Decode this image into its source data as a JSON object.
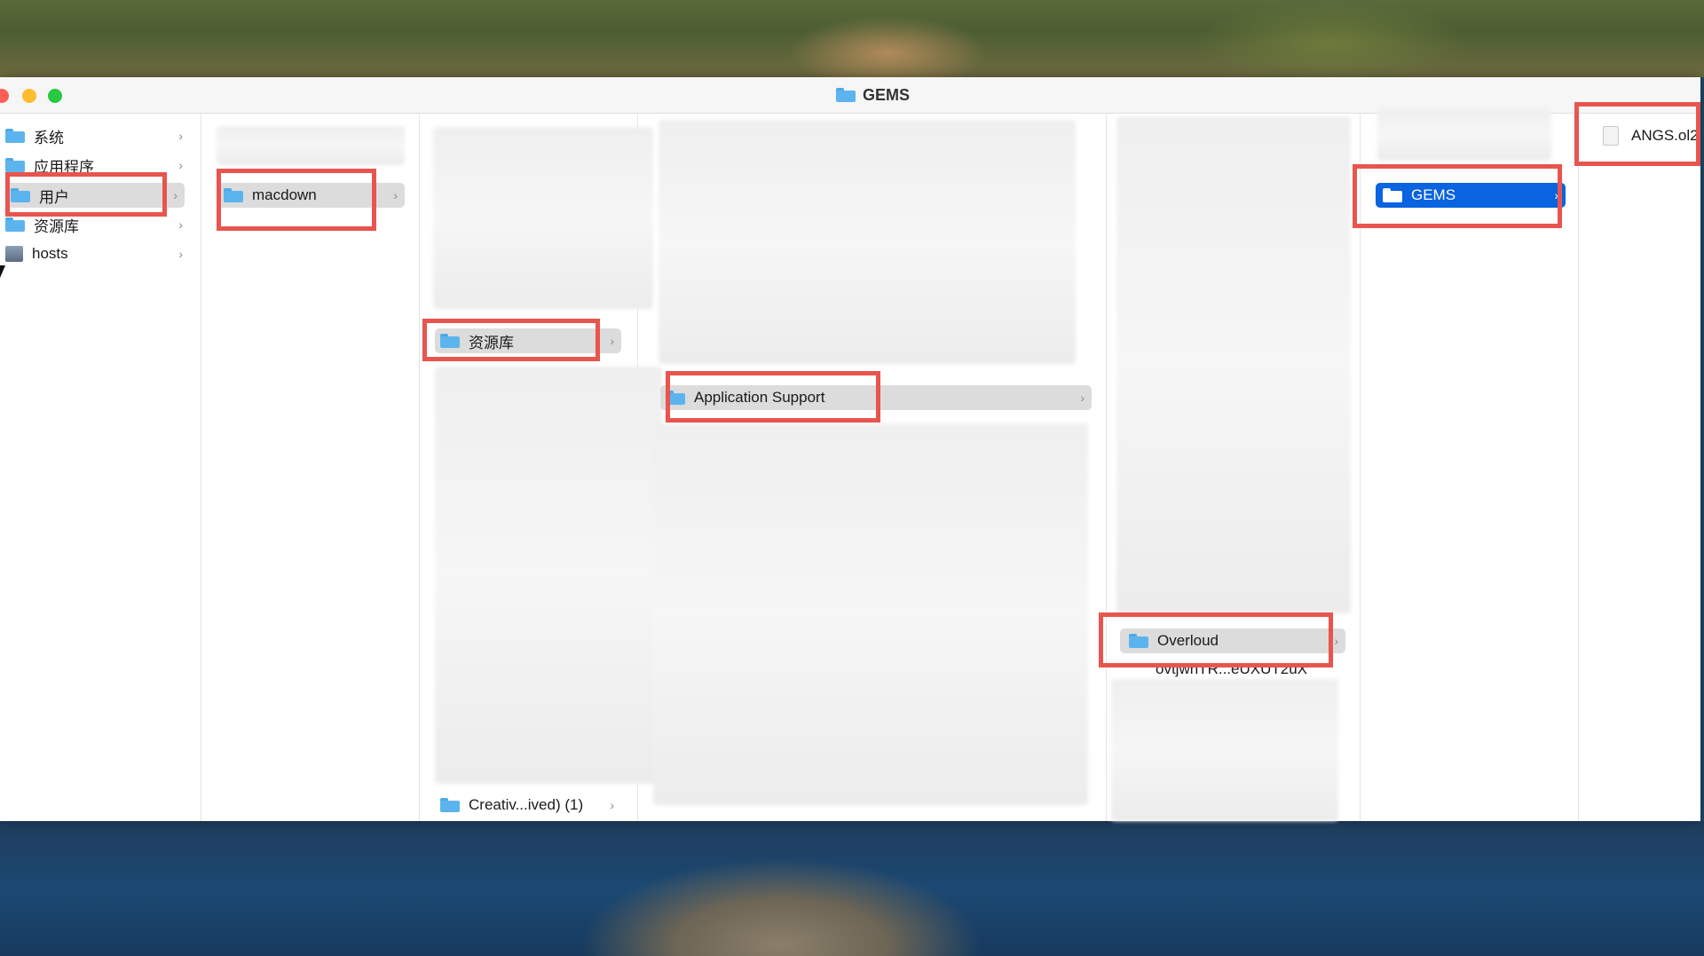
{
  "window": {
    "title": "GEMS"
  },
  "columns": {
    "sidebar": [
      {
        "label": "系统",
        "icon": "folder-icon"
      },
      {
        "label": "应用程序",
        "icon": "folder-icon"
      },
      {
        "label": "用户",
        "icon": "folder-icon",
        "selected": true
      },
      {
        "label": "资源库",
        "icon": "folder-icon"
      },
      {
        "label": "hosts",
        "icon": "disk-icon"
      }
    ],
    "col2": [
      {
        "label": "macdown",
        "selected": true
      }
    ],
    "col3": [
      {
        "label": "资源库",
        "selected": true
      },
      {
        "label": "Creativ...ived) (1)"
      }
    ],
    "col4": [
      {
        "label": "Application Support",
        "selected": true
      }
    ],
    "col5": [
      {
        "label": "Overloud",
        "selected": true
      },
      {
        "label": "ovtjwhTR...eUXUT2uX"
      }
    ],
    "col6": [
      {
        "label": "GEMS",
        "selected": true,
        "active": true
      }
    ],
    "col7": [
      {
        "label": "ANGS.ol2",
        "icon": "document-icon"
      }
    ]
  },
  "colors": {
    "highlight_box": "#e8554e",
    "selection_active": "#0a63e0",
    "selection_inactive": "#dcdcdc"
  }
}
